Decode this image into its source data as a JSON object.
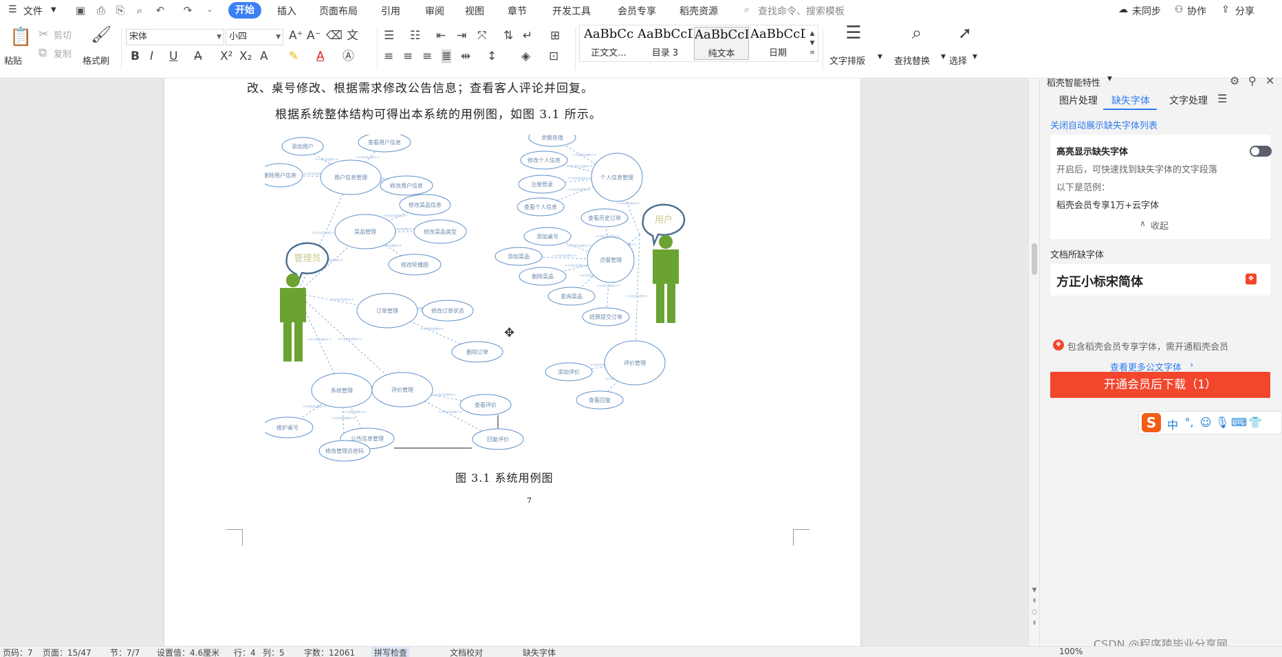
{
  "menubar": {
    "file": "文件",
    "tabs": [
      "开始",
      "插入",
      "页面布局",
      "引用",
      "审阅",
      "视图",
      "章节",
      "开发工具",
      "会员专享",
      "稻壳资源"
    ],
    "search_placeholder": "查找命令、搜索模板",
    "sync": "未同步",
    "collab": "协作",
    "share": "分享"
  },
  "ribbon": {
    "paste": "粘贴",
    "cut": "剪切",
    "copy": "复制",
    "format_painter": "格式刷",
    "font_name": "宋体",
    "font_size": "小四",
    "styles": [
      {
        "preview": "AaBbCc",
        "name": "正文文..."
      },
      {
        "preview": "AaBbCcD",
        "name": "目录 3"
      },
      {
        "preview": "AaBbCcI",
        "name": "纯文本"
      },
      {
        "preview": "AaBbCcDd",
        "name": "日期"
      }
    ],
    "text_layout": "文字排版",
    "find_replace": "查找替换",
    "select": "选择"
  },
  "document": {
    "line1": "改、桌号修改、根据需求修改公告信息；查看客人评论并回复。",
    "line2": "根据系统整体结构可得出本系统的用例图，如图 3.1 所示。",
    "caption": "图 3.1 系统用例图",
    "page_number": "7"
  },
  "diagram": {
    "actor_admin": "管理员",
    "actor_user": "用户",
    "left_nodes": [
      "添加用户",
      "查看用户信息",
      "删除用户信息",
      "用户信息管理",
      "修改用户信息",
      "修改菜品信息",
      "菜品管理",
      "修改菜品类型",
      "修改轮播图",
      "订单管理",
      "修改订单状态",
      "删除订单",
      "系统管理",
      "评价管理",
      "查看评价",
      "维护桌号",
      "公告信息管理",
      "回复评价",
      "修改管理员密码"
    ],
    "right_nodes": [
      "余额充值",
      "修改个人信息",
      "个人信息管理",
      "注册登录",
      "查看个人信息",
      "查看历史订单",
      "添加桌号",
      "添加菜品",
      "点餐管理",
      "删除菜品",
      "查询菜品",
      "结算提交订单",
      "评价管理",
      "添加评价",
      "查看回复"
    ],
    "edge_label": "<<include>>"
  },
  "panel": {
    "title": "稻壳智能特性",
    "tabs": [
      "图片处理",
      "缺失字体",
      "文字处理"
    ],
    "close_auto": "关闭自动展示缺失字体列表",
    "highlight_title": "高亮显示缺失字体",
    "highlight_desc": "开启后，可快速找到缺失字体的文字段落",
    "example_label": "以下是范例：",
    "example_text": "稻壳会员专享1万+云字体",
    "collapse": "收起",
    "missing_title": "文档所缺字体",
    "missing_font": "方正小标宋简体",
    "download_btn": "开通会员后下载（1）",
    "member_note": "包含稻壳会员专享字体，需开通稻壳会员",
    "more_fonts": "查看更多公文字体"
  },
  "ime": {
    "lang": "中"
  },
  "statusbar": {
    "page": "页码：7",
    "pages": "页面：15/47",
    "section": "节：7/7",
    "setting": "设置值：4.6厘米",
    "row": "行：4",
    "col": "列：5",
    "words": "字数：12061",
    "spell": "拼写检查",
    "proof": "文档校对",
    "missing_font": "缺失字体",
    "zoom": "100%"
  },
  "watermark": "CSDN @程序猿毕业分享网",
  "colors": {
    "accent": "#3d7ff5",
    "danger": "#f2462d",
    "actor": "#6aa332",
    "ellipse": "#5b8fc9"
  }
}
